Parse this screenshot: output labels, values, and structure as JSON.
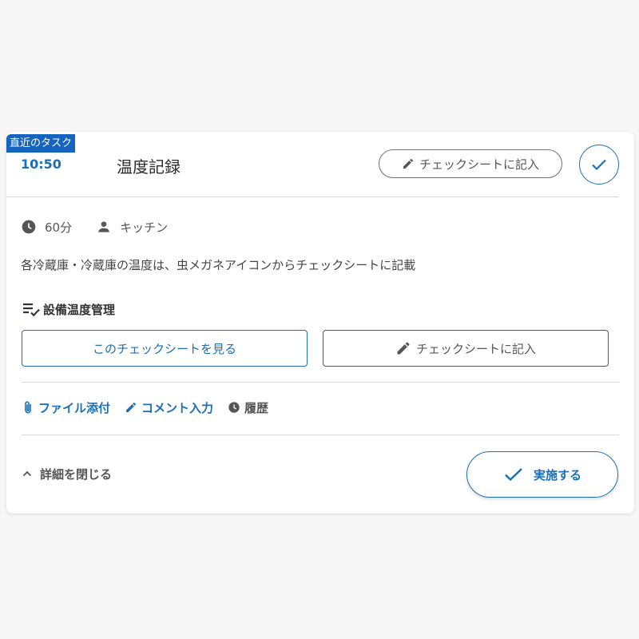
{
  "task": {
    "badge": "直近のタスク",
    "time": "10:50",
    "title": "温度記録",
    "header_record_label": "チェックシートに記入",
    "duration": "60分",
    "assignee": "キッチン",
    "description": "各冷蔵庫・冷蔵庫の温度は、虫メガネアイコンからチェックシートに記載"
  },
  "checksheet": {
    "section_title": "設備温度管理",
    "view_label": "このチェックシートを見る",
    "record_label": "チェックシートに記入"
  },
  "actions": {
    "attach_label": "ファイル添付",
    "comment_label": "コメント入力",
    "history_label": "履歴"
  },
  "footer": {
    "collapse_label": "詳細を閉じる",
    "execute_label": "実施する"
  },
  "colors": {
    "accent": "#1a6fb6",
    "badge": "#1565c0",
    "text": "#333333",
    "muted": "#555555"
  },
  "icons": [
    "pencil-icon",
    "check-icon",
    "clock-icon",
    "person-icon",
    "checklist-icon",
    "paperclip-icon",
    "history-icon",
    "chevron-up-icon"
  ]
}
